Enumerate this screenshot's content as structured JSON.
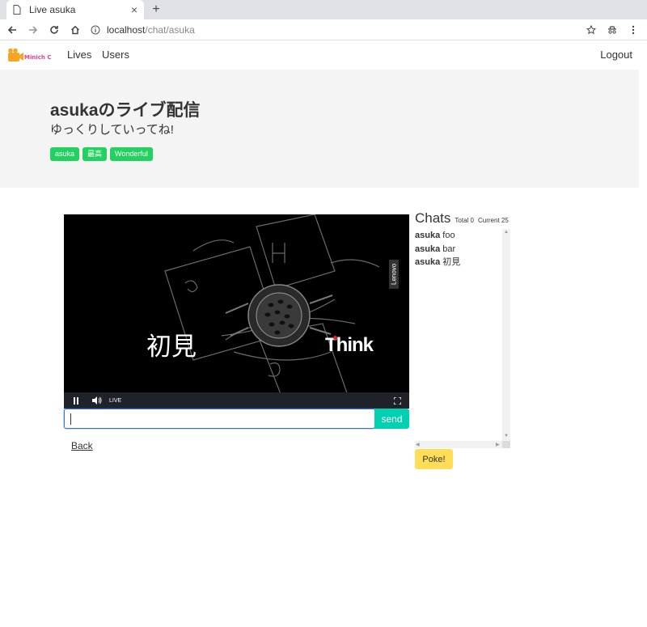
{
  "browser": {
    "tab_title": "Live asuka",
    "url_host": "localhost",
    "url_path": "/chat/asuka"
  },
  "navbar": {
    "logo_text": "Minich C",
    "links": [
      "Lives",
      "Users"
    ],
    "logout": "Logout"
  },
  "hero": {
    "title": "asukaのライブ配信",
    "subtitle": "ゆっくりしていってね!",
    "tags": [
      "asuka",
      "最高",
      "Wonderful"
    ]
  },
  "video": {
    "caption": "初見",
    "brand": "Think",
    "side_brand": "Lenovo",
    "live_label": "LIVE"
  },
  "chat_input": {
    "value": "",
    "send_label": "send"
  },
  "back_link": "Back",
  "chats": {
    "title": "Chats",
    "total": "Total 0",
    "current": "Current 25",
    "messages": [
      {
        "user": "asuka",
        "text": "foo"
      },
      {
        "user": "asuka",
        "text": "bar"
      },
      {
        "user": "asuka",
        "text": "初見"
      }
    ],
    "poke_label": "Poke!"
  },
  "colors": {
    "tag": "#23d160",
    "send": "#00d1b2",
    "poke": "#ffdd57",
    "focus": "#3273dc"
  }
}
